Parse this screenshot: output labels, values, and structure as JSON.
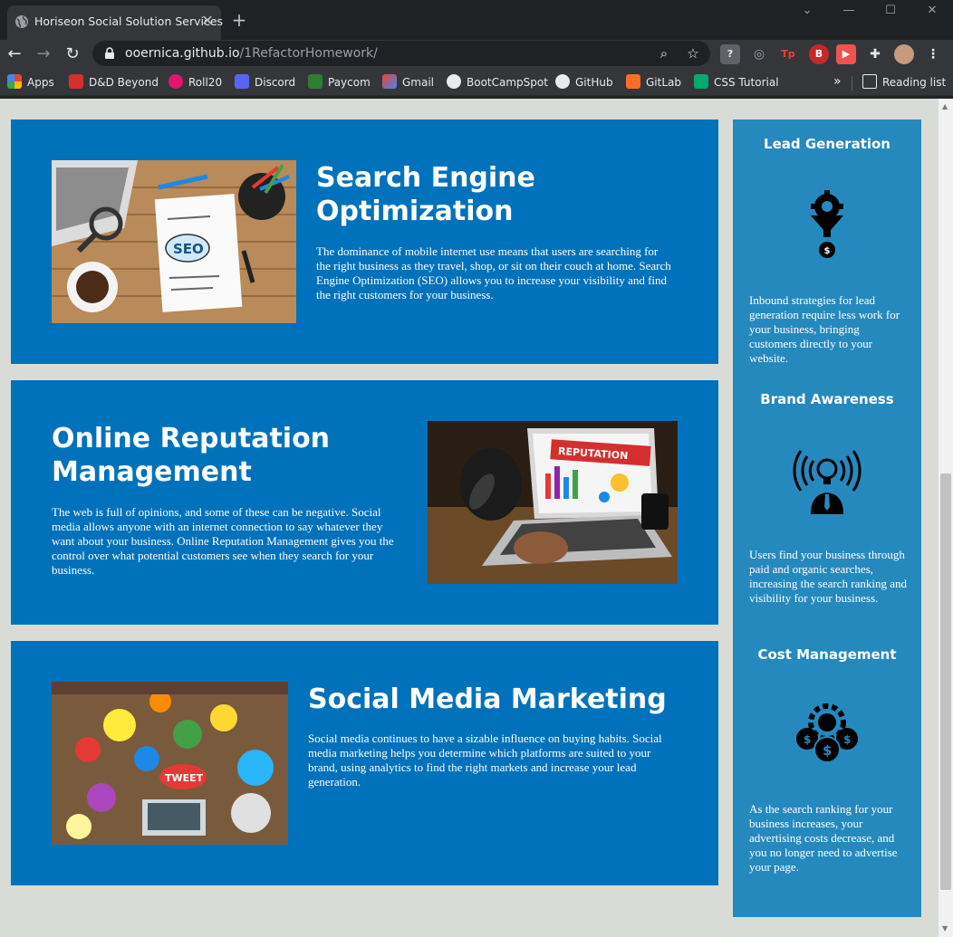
{
  "browser": {
    "tab_title": "Horiseon Social Solution Services",
    "url_host": "ooernica.github.io",
    "url_path": "/1RefactorHomework/",
    "bookmarks": [
      "Apps",
      "D&D Beyond",
      "Roll20",
      "Discord",
      "Paycom",
      "Gmail",
      "BootCampSpot",
      "GitHub",
      "GitLab",
      "CSS Tutorial"
    ],
    "reading_list": "Reading list",
    "overflow": "»"
  },
  "sections": [
    {
      "title_line1": "Search Engine",
      "title_line2": "Optimization",
      "body": "The dominance of mobile internet use means that users are searching for the right business as they travel, shop, or sit on their couch at home. Search Engine Optimization (SEO) allows you to increase your visibility and find the right customers for your business.",
      "image_text": "SEO"
    },
    {
      "title_line1": "Online Reputation",
      "title_line2": "Management",
      "body": "The web is full of opinions, and some of these can be negative. Social media allows anyone with an internet connection to say whatever they want about your business. Online Reputation Management gives you the control over what potential customers see when they search for your business.",
      "image_text": "REPUTATION"
    },
    {
      "title_line1": "Social Media Marketing",
      "title_line2": "",
      "body": "Social media continues to have a sizable influence on buying habits. Social media marketing helps you determine which platforms are suited to your brand, using analytics to find the right markets and increase your lead generation.",
      "image_text": "TWEET"
    }
  ],
  "benefits": [
    {
      "title": "Lead Generation",
      "icon": "lead-generation-icon",
      "body": "Inbound strategies for lead generation require less work for your business, bringing customers directly to your website."
    },
    {
      "title": "Brand Awareness",
      "icon": "brand-awareness-icon",
      "body": "Users find your business through paid and organic searches, increasing the search ranking and visibility for your business."
    },
    {
      "title": "Cost Management",
      "icon": "cost-management-icon",
      "body": "As the search ranking for your business increases, your advertising costs decrease, and you no longer need to advertise your page."
    }
  ],
  "colors": {
    "card_bg": "#0072bb",
    "aside_bg": "#2589bd",
    "page_bg": "#d9dcd6"
  }
}
